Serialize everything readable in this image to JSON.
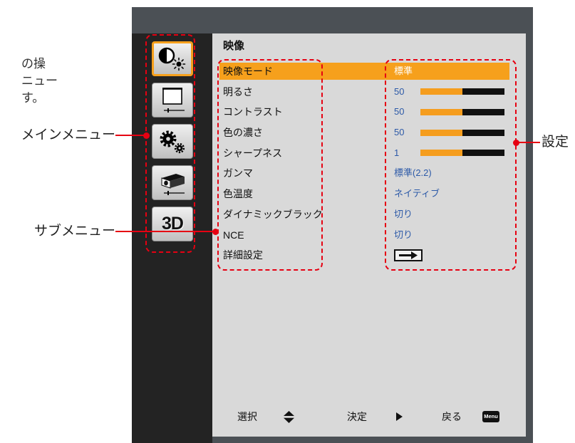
{
  "annotations": {
    "intro_lines": [
      "の操",
      "ニュー",
      "す。"
    ],
    "main_menu_callout": "メインメニュー",
    "sub_menu_callout": "サブメニュー",
    "settings_callout": "設定",
    "callout_color": "#e60012"
  },
  "osd": {
    "main_menu": [
      {
        "icon": "picture-contrast-icon",
        "selected": true
      },
      {
        "icon": "screen-display-icon",
        "selected": false
      },
      {
        "icon": "gears-settings-icon",
        "selected": false
      },
      {
        "icon": "projector-icon",
        "selected": false
      },
      {
        "icon": "3d-icon",
        "label": "3D",
        "selected": false
      }
    ],
    "section_title": "映像",
    "items": [
      {
        "label": "映像モード",
        "value": "標準",
        "highlighted": true
      },
      {
        "label": "明るさ",
        "value": "50",
        "level": 0.5
      },
      {
        "label": "コントラスト",
        "value": "50",
        "level": 0.5
      },
      {
        "label": "色の濃さ",
        "value": "50",
        "level": 0.5
      },
      {
        "label": "シャープネス",
        "value": "1",
        "level": 0.5
      },
      {
        "label": "ガンマ",
        "value": "標準(2.2)"
      },
      {
        "label": "色温度",
        "value": "ネイティブ"
      },
      {
        "label": "ダイナミックブラック",
        "value": "切り"
      },
      {
        "label": "NCE",
        "value": "切り"
      },
      {
        "label": "詳細設定",
        "icon": "enter-arrow-icon"
      }
    ],
    "footer": {
      "select_label": "選択",
      "select_icon": "up-down-arrow-icon",
      "enter_label": "決定",
      "enter_icon": "right-triangle-icon",
      "back_label": "戻る",
      "back_key_label": "Menu"
    }
  },
  "colors": {
    "frame": "#4b5055",
    "menu_column": "#232323",
    "panel": "#d9d9d9",
    "highlight": "#f6a01c",
    "value_text": "#2d5aa8",
    "slider_track": "#111111",
    "slider_fill": "#f59d1e"
  }
}
